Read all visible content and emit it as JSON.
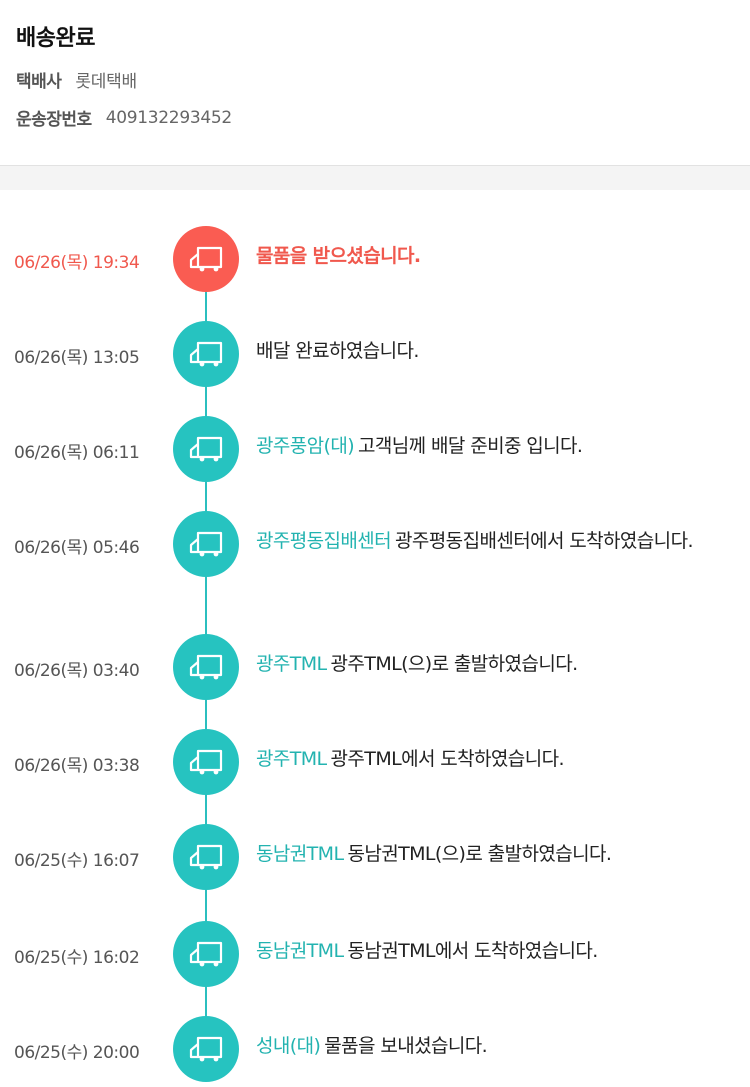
{
  "header": {
    "status": "배송완료",
    "carrier_label": "택배사",
    "carrier_value": "롯데택배",
    "tracking_label": "운송장번호",
    "tracking_value": "409132293452"
  },
  "colors": {
    "accent": "#26c3c0",
    "active": "#fa5c52"
  },
  "events": [
    {
      "time": "06/26(목) 19:34",
      "location": "",
      "message": "물품을 받으셨습니다."
    },
    {
      "time": "06/26(목) 13:05",
      "location": "",
      "message": "배달 완료하였습니다."
    },
    {
      "time": "06/26(목) 06:11",
      "location": "광주풍암(대)",
      "message": "고객님께 배달 준비중 입니다."
    },
    {
      "time": "06/26(목) 05:46",
      "location": "광주평동집배센터",
      "message": "광주평동집배센터에서 도착하였습니다."
    },
    {
      "time": "06/26(목) 03:40",
      "location": "광주TML",
      "message": "광주TML(으)로 출발하였습니다."
    },
    {
      "time": "06/26(목) 03:38",
      "location": "광주TML",
      "message": "광주TML에서 도착하였습니다."
    },
    {
      "time": "06/25(수) 16:07",
      "location": "동남권TML",
      "message": "동남권TML(으)로 출발하였습니다."
    },
    {
      "time": "06/25(수) 16:02",
      "location": "동남권TML",
      "message": "동남권TML에서 도착하였습니다."
    },
    {
      "time": "06/25(수) 20:00",
      "location": "성내(대)",
      "message": "물품을 보내셨습니다."
    }
  ]
}
